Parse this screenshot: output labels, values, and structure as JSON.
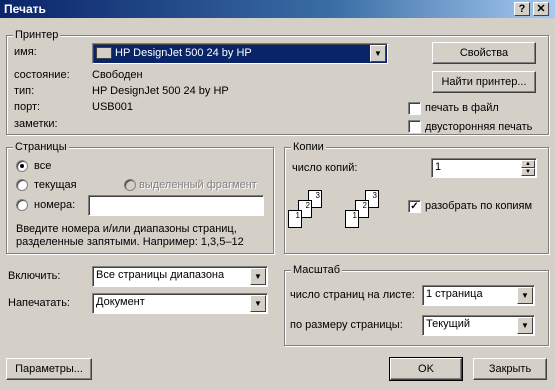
{
  "window": {
    "title": "Печать",
    "help_btn": "?",
    "close_btn": "✕"
  },
  "printer": {
    "group_label": "Принтер",
    "name_label": "имя:",
    "name_value": "HP DesignJet 500 24 by HP",
    "status_label": "состояние:",
    "status_value": "Свободен",
    "type_label": "тип:",
    "type_value": "HP DesignJet 500 24 by HP",
    "port_label": "порт:",
    "port_value": "USB001",
    "notes_label": "заметки:",
    "properties_btn": "Свойства",
    "find_btn": "Найти принтер...",
    "print_to_file": "печать в файл",
    "duplex": "двусторонняя печать"
  },
  "pages": {
    "group_label": "Страницы",
    "all": "все",
    "current": "текущая",
    "selection": "выделенный фрагмент",
    "numbers": "номера:",
    "numbers_value": "",
    "hint": "Введите номера и/или диапазоны страниц, разделенные запятыми. Например: 1,3,5–12"
  },
  "copies": {
    "group_label": "Копии",
    "count_label": "число копий:",
    "count_value": "1",
    "collate": "разобрать по копиям",
    "collate_checked": true,
    "page_digits": [
      "3",
      "2",
      "1",
      "3",
      "2",
      "1"
    ]
  },
  "include": {
    "label": "Включить:",
    "value": "Все страницы диапазона"
  },
  "print_what": {
    "label": "Напечатать:",
    "value": "Документ"
  },
  "scale": {
    "group_label": "Масштаб",
    "pps_label": "число страниц на листе:",
    "pps_value": "1 страница",
    "fit_label": "по размеру страницы:",
    "fit_value": "Текущий"
  },
  "footer": {
    "options_btn": "Параметры...",
    "ok_btn": "OK",
    "close_btn": "Закрыть"
  }
}
